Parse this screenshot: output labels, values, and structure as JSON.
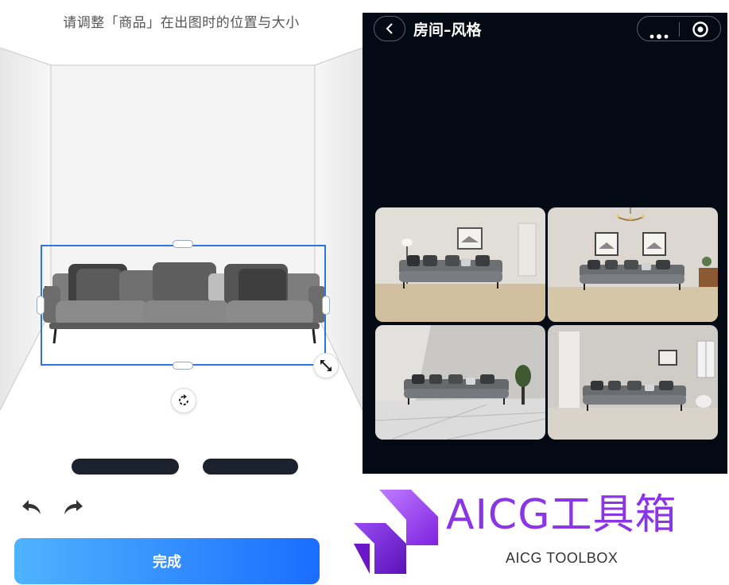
{
  "editor": {
    "hint": "请调整「商品」在出图时的位置与大小",
    "done_label": "完成"
  },
  "phone": {
    "title": "房间–风格"
  },
  "logo": {
    "title": "AICG工具箱",
    "subtitle": "AICG TOOLBOX"
  },
  "icons": {
    "undo": "undo-arrow-icon",
    "redo": "redo-arrow-icon",
    "resize": "resize-diagonal-icon",
    "rotate": "rotate-icon",
    "back": "chevron-left-icon",
    "more": "more-dots-icon",
    "close": "target-circle-icon"
  },
  "colors": {
    "selection": "#2b74e2",
    "button_gradient_start": "#4fb3ff",
    "button_gradient_end": "#1b6dff",
    "phone_background": "#040a13",
    "logo_purple": "#8a35e6"
  }
}
